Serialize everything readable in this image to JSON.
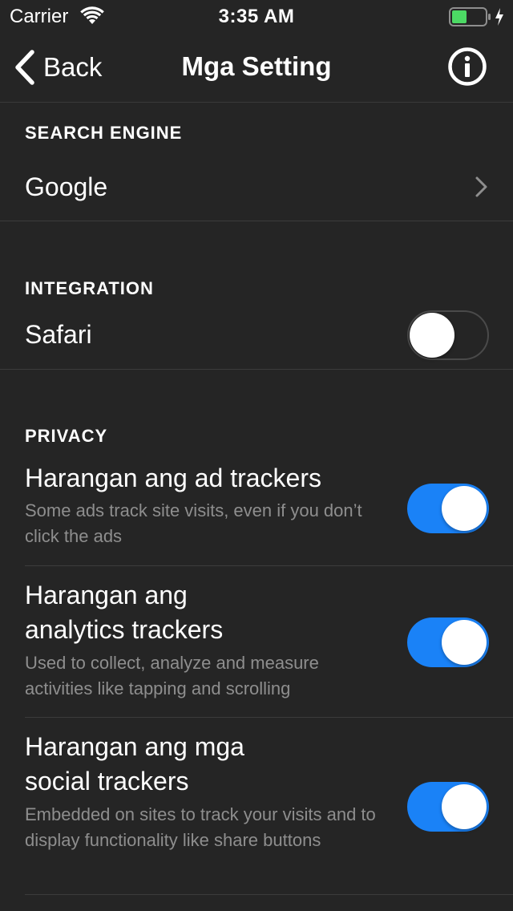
{
  "status_bar": {
    "carrier": "Carrier",
    "time": "3:35 AM",
    "battery_color": "#4cd964"
  },
  "nav": {
    "back_label": "Back",
    "title": "Mga Setting",
    "info_icon": "info-circle-icon"
  },
  "search_engine": {
    "header": "SEARCH ENGINE",
    "value": "Google"
  },
  "integration": {
    "header": "INTEGRATION",
    "safari_label": "Safari",
    "safari_enabled": false
  },
  "privacy": {
    "header": "PRIVACY",
    "items": [
      {
        "title": "Harangan ang ad trackers",
        "description": "Some ads track site visits, even if you don’t click the ads",
        "enabled": true
      },
      {
        "title": "Harangan ang analytics trackers",
        "description": "Used to collect, analyze and measure activities like tapping and scrolling",
        "enabled": true
      },
      {
        "title": "Harangan ang mga social trackers",
        "description": "Embedded on sites to track your visits and to display functionality like share buttons",
        "enabled": true
      }
    ]
  },
  "colors": {
    "background": "#252525",
    "toggle_on": "#1a82f7",
    "secondary_text": "#8e8e8e"
  }
}
